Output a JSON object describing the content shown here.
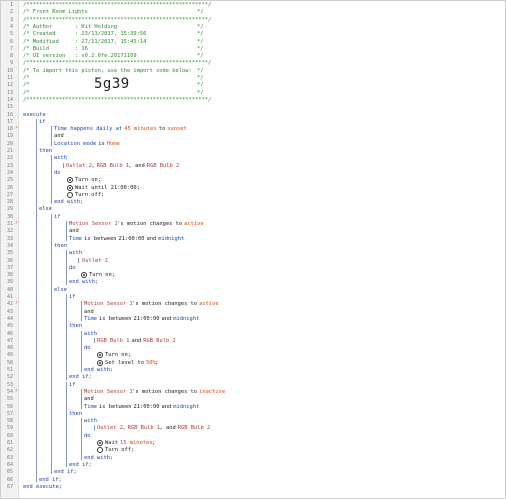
{
  "editor": {
    "header": {
      "rule": "/********************************************************/",
      "name_line": "/* Front Room Lights",
      "author_line": "/* Author       : Kit Holding",
      "created_line": "/* Created      : 23/11/2017, 15:39:56",
      "modified_line": "/* Modified     : 27/11/2017, 15:45:14",
      "build_line": "/* Build        : 16",
      "ui_line": "/* UI version   : v0.2.0fe.20171109",
      "import_line": "/* To import this piston, use the import code below:",
      "empty_line": "/*",
      "import_code": "5g39",
      "close": "*/"
    },
    "lines": [
      "1",
      "2",
      "3",
      "4",
      "5",
      "6",
      "7",
      "8",
      "9",
      "10",
      "11",
      "12",
      "13",
      "14",
      "15",
      "16",
      "17",
      "18",
      "19",
      "20",
      "21",
      "22",
      "23",
      "24",
      "25",
      "26",
      "27",
      "28",
      "29",
      "30",
      "31",
      "32",
      "33",
      "34",
      "35",
      "36",
      "37",
      "38",
      "39",
      "40",
      "41",
      "42",
      "43",
      "44",
      "45",
      "46",
      "47",
      "48",
      "49",
      "50",
      "51",
      "52",
      "53",
      "54",
      "55",
      "56",
      "57",
      "58",
      "59",
      "60",
      "61",
      "62",
      "63",
      "64",
      "65",
      "66",
      "67",
      "68"
    ],
    "bp_marker": "⚡",
    "kw": {
      "execute": "execute",
      "if": "if",
      "and": "and",
      "then": "then",
      "with": "with",
      "do": "do",
      "end_with": "end with;",
      "else": "else",
      "end_if": "end if;",
      "end_execute": "end execute;"
    },
    "cond1": {
      "time_happens": "Time happens daily at",
      "offset": "45 minutes",
      "to": "to",
      "sunset": "sunset",
      "location_mode": "Location mode",
      "is": "is",
      "home": "Home"
    },
    "with1": {
      "outlet2": "Outlet 2",
      "rgb1": "RGB Bulb 1",
      "rgb2": "RGB Bulb 2",
      "sep": ",",
      "and_word": ", and",
      "turn_on": "Turn on;",
      "wait_until": "Wait until 21:00:00;",
      "turn_off": "Turn off;"
    },
    "motion": {
      "sensor1": "Motion Sensor 1",
      "changes_to": "'s motion changes to",
      "active": "active",
      "inactive": "inactive",
      "time_between": "Time",
      "is_between": "is between",
      "t2100": "21:00:00",
      "and_word": "and",
      "midnight": "midnight"
    },
    "actions": {
      "outlet2": "Outlet 2",
      "rgb_pair": "RGB Bulb 1",
      "and_word": "and",
      "rgb2": "RGB Bulb 2",
      "turn_on": "Turn on;",
      "set_level": "Set level to",
      "level_value": "50%",
      "wait": "Wait",
      "wait_value": "15 minutes",
      "turn_off": "Turn off;",
      "semicolon": ";",
      "comma": ",",
      "comma_and": ", and"
    }
  }
}
